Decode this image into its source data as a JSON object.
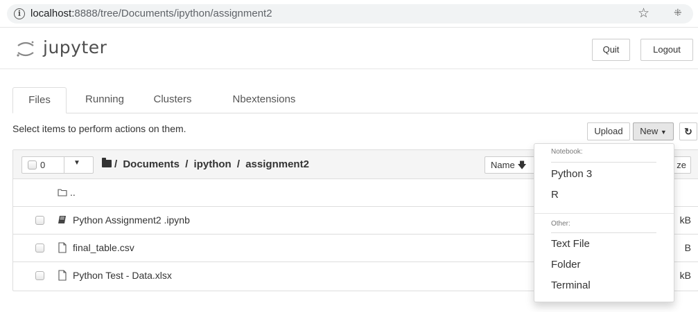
{
  "browser": {
    "url_host": "localhost:",
    "url_rest": "8888/tree/Documents/ipython/assignment2"
  },
  "header": {
    "logo_text": "jupyter",
    "quit_label": "Quit",
    "logout_label": "Logout"
  },
  "tabs": [
    {
      "label": "Files",
      "active": true
    },
    {
      "label": "Running",
      "active": false
    },
    {
      "label": "Clusters",
      "active": false
    },
    {
      "label": "Nbextensions",
      "active": false
    }
  ],
  "toolbar": {
    "select_message": "Select items to perform actions on them.",
    "upload_label": "Upload",
    "new_label": "New",
    "refresh_icon": "refresh-icon"
  },
  "list_header": {
    "selected_count": "0",
    "breadcrumb": [
      "/",
      "Documents",
      "/",
      "ipython",
      "/",
      "assignment2"
    ],
    "name_sort_label": "Name",
    "size_sort_label": "ze"
  },
  "rows": [
    {
      "name": "..",
      "icon": "folder-icon",
      "size": ""
    },
    {
      "name": "Python Assignment2 .ipynb",
      "icon": "notebook-icon",
      "size": "kB"
    },
    {
      "name": "final_table.csv",
      "icon": "file-icon",
      "size": "B"
    },
    {
      "name": "Python Test - Data.xlsx",
      "icon": "file-icon",
      "size": "kB"
    }
  ],
  "new_menu": {
    "notebook_header": "Notebook:",
    "notebook_items": [
      "Python 3",
      "R"
    ],
    "other_header": "Other:",
    "other_items": [
      "Text File",
      "Folder",
      "Terminal"
    ]
  }
}
